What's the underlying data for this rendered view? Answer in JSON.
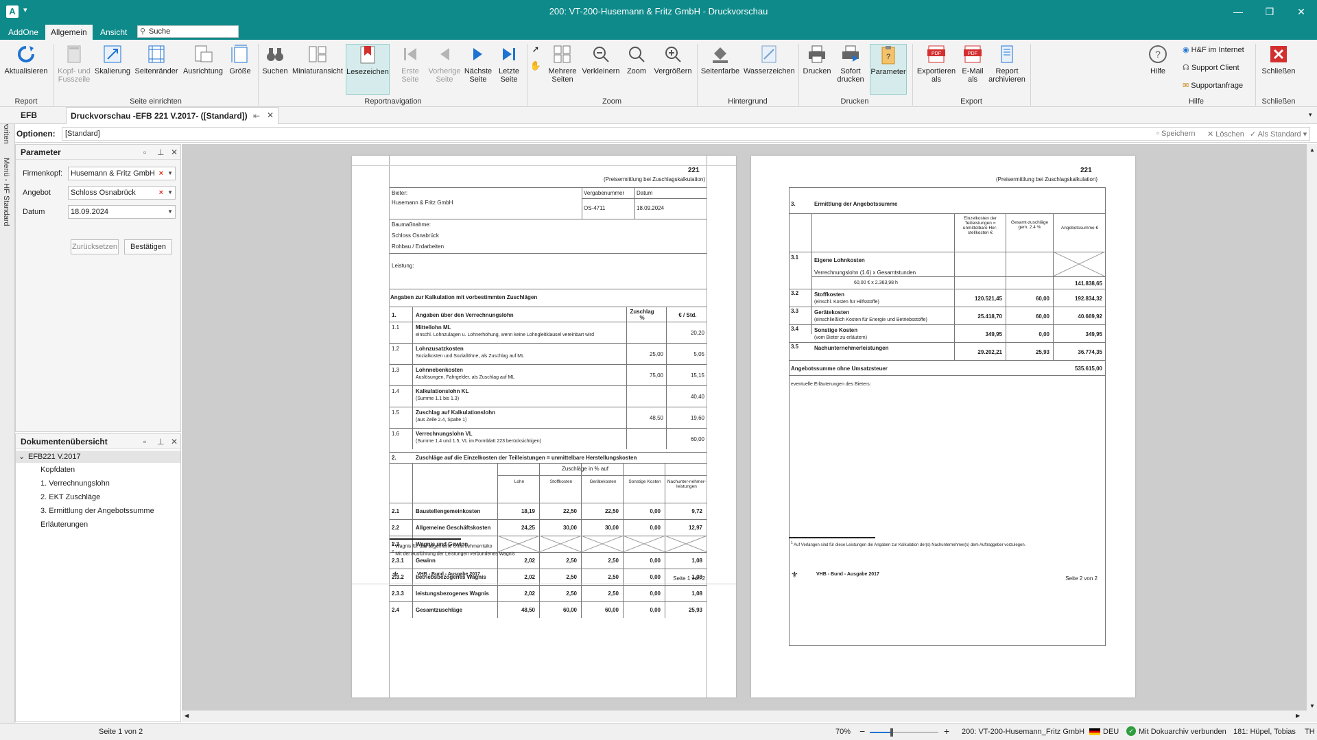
{
  "window": {
    "title": "200: VT-200-Husemann & Fritz GmbH - Druckvorschau",
    "app_icon": "A",
    "minimize": "—",
    "restore": "❐",
    "close": "✕"
  },
  "menu": {
    "tabs": [
      "AddOne",
      "Allgemein",
      "Ansicht"
    ],
    "search_placeholder": "Suche"
  },
  "ribbon": {
    "buttons": {
      "aktualisieren": "Aktualisieren",
      "kopf": "Kopf- und Fusszeile",
      "skalierung": "Skalierung",
      "seitenraender": "Seitenränder",
      "ausrichtung": "Ausrichtung",
      "groesse": "Größe",
      "suchen": "Suchen",
      "miniatur": "Miniaturansicht",
      "lesezeichen": "Lesezeichen",
      "erste": "Erste Seite",
      "vorherige": "Vorherige Seite",
      "naechste": "Nächste Seite",
      "letzte": "Letzte Seite",
      "mehrere": "Mehrere Seiten",
      "verkleinern": "Verkleinern",
      "zoom": "Zoom",
      "vergroessern": "Vergrößern",
      "seitenfarbe": "Seitenfarbe",
      "wasserzeichen": "Wasserzeichen",
      "drucken": "Drucken",
      "sofort": "Sofort drucken",
      "parameter": "Parameter",
      "exportieren": "Exportieren als",
      "email": "E-Mail als",
      "report_archivieren": "Report archivieren",
      "hilfe": "Hilfe",
      "hf_internet": "H&F im Internet",
      "support_client": "Support Client",
      "supportanfrage": "Supportanfrage",
      "schliessen": "Schließen"
    },
    "groups": {
      "report": "Report",
      "seite": "Seite einrichten",
      "nav": "Reportnavigation",
      "zoom": "Zoom",
      "hintergrund": "Hintergrund",
      "drucken": "Drucken",
      "export": "Export",
      "hilfe": "Hilfe",
      "schliessen": "Schließen"
    }
  },
  "doctabs": {
    "efb": "EFB",
    "active": "Druckvorschau -EFB 221 V.2017- ([Standard])"
  },
  "options": {
    "label": "Optionen:",
    "value": "[Standard]",
    "speichern": "Speichern",
    "loeschen": "Löschen",
    "als_standard": "Als Standard"
  },
  "vstrip": [
    "Favoriten",
    "Menü - HF Standard"
  ],
  "parameter_panel": {
    "title": "Parameter",
    "firmenkopf_label": "Firmenkopf:",
    "firmenkopf_value": "Husemann & Fritz GmbH",
    "angebot_label": "Angebot",
    "angebot_value": "Schloss Osnabrück",
    "datum_label": "Datum",
    "datum_value": "18.09.2024",
    "reset": "Zurücksetzen",
    "confirm": "Bestätigen"
  },
  "overview_panel": {
    "title": "Dokumentenübersicht",
    "root": "EFB221 V.2017",
    "items": [
      "Kopfdaten",
      "1. Verrechnungslohn",
      "2. EKT Zuschläge",
      "3. Ermittlung der Angebotssumme",
      "Erläuterungen"
    ]
  },
  "page1": {
    "number": "221",
    "subtitle": "(Preisermittlung bei Zuschlagskalkulation)",
    "bieter_label": "Bieter:",
    "bieter": "Husemann & Fritz GmbH",
    "vergabenummer_label": "Vergabenummer",
    "vergabenummer": "OS-4711",
    "datum_label": "Datum",
    "datum": "18.09.2024",
    "baumassnahme_label": "Baumaßnahme:",
    "baumassnahme": "Schloss Osnabrück",
    "baumassnahme2": "Rohbau / Erdarbeiten",
    "leistung_label": "Leistung:",
    "section_title": "Angaben zur Kalkulation mit vorbestimmten Zuschlägen",
    "s1_no": "1.",
    "s1_title": "Angaben über den Verrechnungslohn",
    "s1_col1": "Zuschlag %",
    "s1_col2": "€ / Std.",
    "rows1": [
      {
        "no": "1.1",
        "title": "Mittellohn ML",
        "sub": "einschl. Lohnzulagen u. Lohnerhöhung, wenn keine Lohngleitklausel vereinbart wird",
        "pct": "",
        "val": "20,20"
      },
      {
        "no": "1.2",
        "title": "Lohnzusatzkosten",
        "sub": "Sozialkosten und Soziallöhne, als Zuschlag auf ML",
        "pct": "25,00",
        "val": "5,05"
      },
      {
        "no": "1.3",
        "title": "Lohnnebenkosten",
        "sub": "Auslösungen, Fahrgelder, als Zuschlag auf ML",
        "pct": "75,00",
        "val": "15,15"
      },
      {
        "no": "1.4",
        "title": "Kalkulationslohn KL",
        "sub": "(Summe 1.1 bis 1.3)",
        "pct": "",
        "val": "40,40"
      },
      {
        "no": "1.5",
        "title": "Zuschlag auf Kalkulationslohn",
        "sub": "(aus Zeile 2.4, Spalte 1)",
        "pct": "48,50",
        "val": "19,60"
      },
      {
        "no": "1.6",
        "title": "Verrechnungslohn VL",
        "sub": "(Summe 1.4 und 1.5, VL im Formblatt 223 berücksichtigen)",
        "pct": "",
        "val": "60,00"
      }
    ],
    "s2_no": "2.",
    "s2_title": "Zuschläge auf die Einzelkosten der Teilleistungen = unmittelbare Herstellungskosten",
    "s2_header": "Zuschläge in % auf",
    "s2_cols": [
      "Lohn",
      "Stoffkosten",
      "Gerätekosten",
      "Sonstige Kosten",
      "Nachunter-nehmer-leistungen"
    ],
    "rows2": [
      {
        "no": "2.1",
        "title": "Baustellengemeinkosten",
        "v": [
          "18,19",
          "22,50",
          "22,50",
          "0,00",
          "9,72"
        ]
      },
      {
        "no": "2.2",
        "title": "Allgemeine Geschäftskosten",
        "v": [
          "24,25",
          "30,00",
          "30,00",
          "0,00",
          "12,97"
        ]
      },
      {
        "no": "2.3",
        "title": "Wagnis und Gewinn",
        "v": [
          "",
          "",
          "",
          "",
          ""
        ]
      },
      {
        "no": "2.3.1",
        "title": "Gewinn",
        "v": [
          "2,02",
          "2,50",
          "2,50",
          "0,00",
          "1,08"
        ]
      },
      {
        "no": "2.3.2",
        "title": "betriebsbezogenes Wagnis",
        "v": [
          "2,02",
          "2,50",
          "2,50",
          "0,00",
          "1,08"
        ]
      },
      {
        "no": "2.3.3",
        "title": "leistungsbezogenes Wagnis",
        "v": [
          "2,02",
          "2,50",
          "2,50",
          "0,00",
          "1,08"
        ]
      },
      {
        "no": "2.4",
        "title": "Gesamtzuschläge",
        "v": [
          "48,50",
          "60,00",
          "60,00",
          "0,00",
          "25,93"
        ]
      }
    ],
    "fn1": "Wagnis für das allgemeine Unternehmerrisiko",
    "fn2": "Mit der Ausführung der Leistungen verbundenes Wagnis",
    "footer": "VHB - Bund - Ausgabe 2017",
    "pageno": "Seite 1 von 2"
  },
  "page2": {
    "number": "221",
    "subtitle": "(Preisermittlung bei Zuschlagskalkulation)",
    "s3_no": "3.",
    "s3_title": "Ermittlung der Angebotssumme",
    "cols": [
      "Einzelkosten der Teilleistungen = unmittelbare Her-stellkosten €",
      "Gesamt-zuschläge gem. 2.4 %",
      "Angebotssumme €"
    ],
    "r31_no": "3.1",
    "r31_title": "Eigene Lohnkosten",
    "r31_sub": "Verrechnungslohn (1.6) x   Gesamtstunden",
    "r31_calc": "60,00 €   x   2.363,98 h",
    "r31_sum": "141.838,65",
    "rows": [
      {
        "no": "3.2",
        "title": "Stoffkosten",
        "sub": "(einschl. Kosten für Hilfsstoffe)",
        "ek": "120.521,45",
        "pct": "60,00",
        "sum": "192.834,32"
      },
      {
        "no": "3.3",
        "title": "Gerätekosten",
        "sub": "(einschließlich Kosten für Energie und Betriebsstoffe)",
        "ek": "25.418,70",
        "pct": "60,00",
        "sum": "40.669,92"
      },
      {
        "no": "3.4",
        "title": "Sonstige Kosten",
        "sub": "(vom Bieter zu erläutern)",
        "ek": "349,95",
        "pct": "0,00",
        "sum": "349,95"
      },
      {
        "no": "3.5",
        "title": "Nachunternehmerleistungen",
        "sub": "",
        "ek": "29.202,21",
        "pct": "25,93",
        "sum": "36.774,35"
      }
    ],
    "total_label": "Angebotssumme ohne Umsatzsteuer",
    "total": "535.615,00",
    "erl": "eventuelle Erläuterungen des Bieters:",
    "fn": "Auf Verlangen sind für diese Leistungen die Angaben zur Kalkulation der(s) Nachunternehmer(s) dem Auftraggeber vorzulegen.",
    "footer": "VHB - Bund - Ausgabe 2017",
    "pageno": "Seite 2 von 2"
  },
  "status": {
    "page": "Seite 1 von 2",
    "zoom": "70%",
    "zoom_level": 0.7,
    "company": "200: VT-200-Husemann_Fritz GmbH",
    "lang": "DEU",
    "archive": "Mit Dokuarchiv verbunden",
    "user": "181: Hüpel, Tobias",
    "initials": "TH"
  },
  "colors": {
    "accent": "#0e8a8a",
    "close_red": "#d32f2f",
    "pdf_red": "#d32f2f",
    "nav_blue": "#1e73d2"
  }
}
